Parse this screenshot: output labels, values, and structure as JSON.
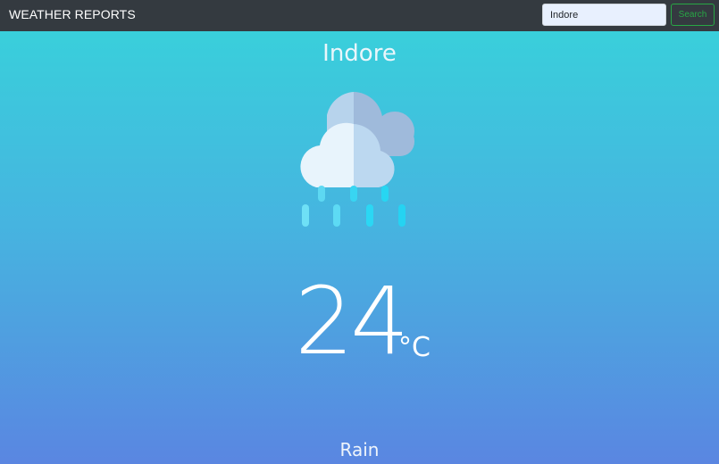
{
  "header": {
    "brand": "WEATHER REPORTS",
    "search": {
      "value": "Indore",
      "button_label": "Search"
    }
  },
  "weather": {
    "city": "Indore",
    "icon": "rain-cloud-icon",
    "temperature": "24",
    "unit": "°C",
    "condition": "Rain"
  },
  "colors": {
    "navbar": "#343a40",
    "gradient_top": "#39cfdb",
    "gradient_bottom": "#5a86e1",
    "search_button": "#28a745"
  }
}
